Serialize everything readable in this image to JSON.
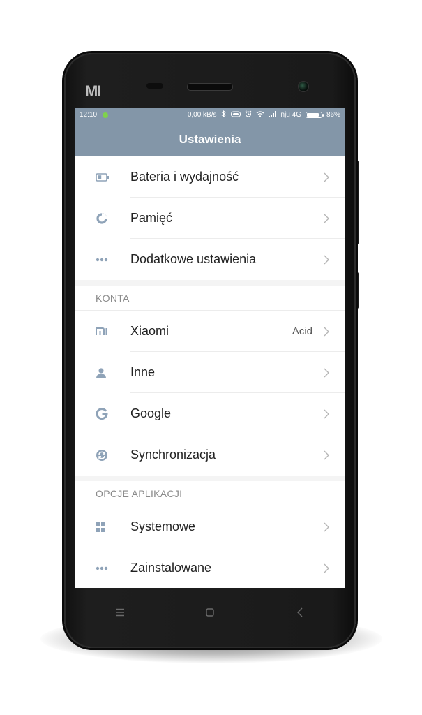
{
  "device": {
    "brand_logo_text": "MI"
  },
  "status_bar": {
    "time": "12:10",
    "net_speed": "0,00 kB/s",
    "carrier": "nju 4G",
    "battery_percent": "86%",
    "battery_level": 0.86,
    "icons": [
      "notification-dot-icon",
      "bluetooth-icon",
      "vr-icon",
      "alarm-icon",
      "wifi-icon",
      "signal-icon",
      "battery-icon"
    ]
  },
  "header": {
    "title": "Ustawienia"
  },
  "section_top": {
    "items": [
      {
        "label": "Bateria i wydajność",
        "icon": "battery-icon"
      },
      {
        "label": "Pamięć",
        "icon": "storage-icon"
      },
      {
        "label": "Dodatkowe ustawienia",
        "icon": "more-dots-icon"
      }
    ]
  },
  "section_accounts": {
    "title": "KONTA",
    "items": [
      {
        "label": "Xiaomi",
        "value": "Acid",
        "icon": "mi-account-icon"
      },
      {
        "label": "Inne",
        "icon": "person-icon"
      },
      {
        "label": "Google",
        "icon": "google-icon"
      },
      {
        "label": "Synchronizacja",
        "icon": "sync-icon"
      }
    ]
  },
  "section_apps": {
    "title": "OPCJE APLIKACJI",
    "items": [
      {
        "label": "Systemowe",
        "icon": "grid-apps-icon"
      },
      {
        "label": "Zainstalowane",
        "icon": "more-dots-icon"
      }
    ]
  },
  "nav_bar": {
    "buttons": [
      "menu-icon",
      "home-icon",
      "back-icon"
    ]
  },
  "colors": {
    "accent": "#8396a8",
    "icon": "#8fa3b8",
    "text": "#222222",
    "chevron": "#b5b5b5"
  }
}
